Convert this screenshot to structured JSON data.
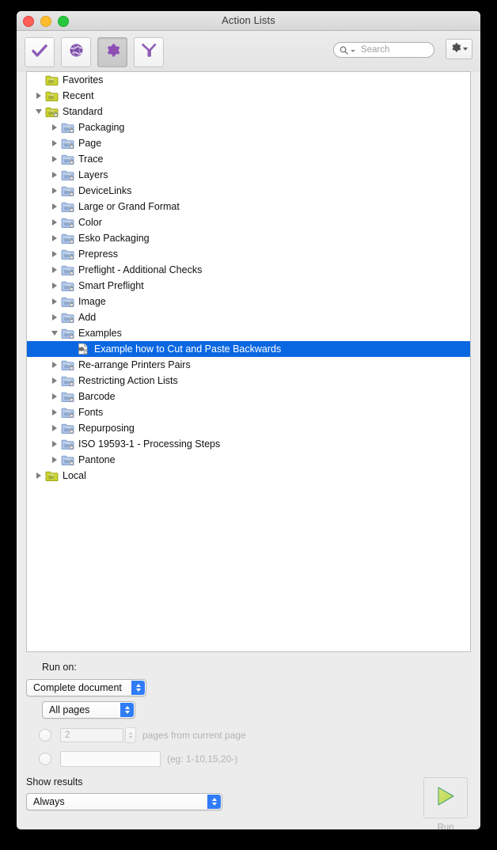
{
  "window": {
    "title": "Action Lists",
    "traffic_lights": [
      "close-button",
      "minimize-button",
      "zoom-button"
    ]
  },
  "toolbar": {
    "buttons": [
      {
        "name": "checkmark-tool",
        "icon": "checkmark-icon",
        "active": false
      },
      {
        "name": "globe-tool",
        "icon": "globe-icon",
        "active": false
      },
      {
        "name": "gear-tool",
        "icon": "gear-icon",
        "active": true
      },
      {
        "name": "funnel-tool",
        "icon": "funnel-icon",
        "active": false
      }
    ],
    "search": {
      "value": "",
      "placeholder": "Search",
      "icon": "search-icon"
    },
    "options_button": {
      "icon": "gear-icon",
      "caret": "chevron-down-icon"
    }
  },
  "tree": {
    "rows": [
      {
        "label": "Favorites",
        "indent": 0,
        "twisty": "none",
        "icon": "folder-gear-yellow-icon",
        "selected": false
      },
      {
        "label": "Recent",
        "indent": 0,
        "twisty": "closed",
        "icon": "folder-gear-yellow-icon",
        "selected": false
      },
      {
        "label": "Standard",
        "indent": 0,
        "twisty": "open",
        "icon": "folder-gear-lock-yellow-icon",
        "selected": false
      },
      {
        "label": "Packaging",
        "indent": 1,
        "twisty": "closed",
        "icon": "folder-gear-lock-blue-icon",
        "selected": false
      },
      {
        "label": "Page",
        "indent": 1,
        "twisty": "closed",
        "icon": "folder-gear-lock-blue-icon",
        "selected": false
      },
      {
        "label": "Trace",
        "indent": 1,
        "twisty": "closed",
        "icon": "folder-gear-lock-blue-icon",
        "selected": false
      },
      {
        "label": "Layers",
        "indent": 1,
        "twisty": "closed",
        "icon": "folder-gear-lock-blue-icon",
        "selected": false
      },
      {
        "label": "DeviceLinks",
        "indent": 1,
        "twisty": "closed",
        "icon": "folder-gear-lock-blue-icon",
        "selected": false
      },
      {
        "label": "Large or Grand Format",
        "indent": 1,
        "twisty": "closed",
        "icon": "folder-gear-lock-blue-icon",
        "selected": false
      },
      {
        "label": "Color",
        "indent": 1,
        "twisty": "closed",
        "icon": "folder-gear-lock-blue-icon",
        "selected": false
      },
      {
        "label": "Esko Packaging",
        "indent": 1,
        "twisty": "closed",
        "icon": "folder-gear-lock-blue-icon",
        "selected": false
      },
      {
        "label": "Prepress",
        "indent": 1,
        "twisty": "closed",
        "icon": "folder-gear-lock-blue-icon",
        "selected": false
      },
      {
        "label": "Preflight - Additional Checks",
        "indent": 1,
        "twisty": "closed",
        "icon": "folder-gear-lock-blue-icon",
        "selected": false
      },
      {
        "label": "Smart Preflight",
        "indent": 1,
        "twisty": "closed",
        "icon": "folder-gear-lock-blue-icon",
        "selected": false
      },
      {
        "label": "Image",
        "indent": 1,
        "twisty": "closed",
        "icon": "folder-gear-lock-blue-icon",
        "selected": false
      },
      {
        "label": "Add",
        "indent": 1,
        "twisty": "closed",
        "icon": "folder-gear-lock-blue-icon",
        "selected": false
      },
      {
        "label": "Examples",
        "indent": 1,
        "twisty": "open",
        "icon": "folder-gear-lock-blue-icon",
        "selected": false
      },
      {
        "label": "Example how to Cut and Paste Backwards",
        "indent": 2,
        "twisty": "none",
        "icon": "action-document-gear-icon",
        "selected": true
      },
      {
        "label": "Re-arrange Printers Pairs",
        "indent": 1,
        "twisty": "closed",
        "icon": "folder-gear-lock-blue-icon",
        "selected": false
      },
      {
        "label": "Restricting Action Lists",
        "indent": 1,
        "twisty": "closed",
        "icon": "folder-gear-lock-blue-icon",
        "selected": false
      },
      {
        "label": "Barcode",
        "indent": 1,
        "twisty": "closed",
        "icon": "folder-gear-lock-blue-icon",
        "selected": false
      },
      {
        "label": "Fonts",
        "indent": 1,
        "twisty": "closed",
        "icon": "folder-gear-lock-blue-icon",
        "selected": false
      },
      {
        "label": "Repurposing",
        "indent": 1,
        "twisty": "closed",
        "icon": "folder-gear-lock-blue-icon",
        "selected": false
      },
      {
        "label": "ISO 19593-1 - Processing Steps",
        "indent": 1,
        "twisty": "closed",
        "icon": "folder-gear-lock-blue-icon",
        "selected": false
      },
      {
        "label": "Pantone",
        "indent": 1,
        "twisty": "closed",
        "icon": "folder-gear-lock-blue-icon",
        "selected": false
      },
      {
        "label": "Local",
        "indent": 0,
        "twisty": "closed",
        "icon": "folder-gear-yellow-icon",
        "selected": false
      }
    ]
  },
  "bottom": {
    "run_on_label": "Run on:",
    "scope_select": {
      "value": "Complete document"
    },
    "pages_select": {
      "value": "All pages"
    },
    "range_radio": {
      "checked": false,
      "value": "2",
      "suffix": "pages from current page"
    },
    "custom_radio": {
      "checked": false,
      "value": "",
      "hint": "(eg: 1-10,15,20-)"
    },
    "show_results_label": "Show results",
    "show_results_select": {
      "value": "Always"
    },
    "run_button": {
      "label": "Run",
      "icon": "play-triangle-icon"
    }
  },
  "colors": {
    "selection_blue": "#0a67e2",
    "popup_arrow_blue": "#2f7cf6",
    "accent_purple": "#8e5cb8",
    "run_green": "#8ec640",
    "folder_yellow": "#c9d22e",
    "folder_blue": "#a8c0e8"
  }
}
